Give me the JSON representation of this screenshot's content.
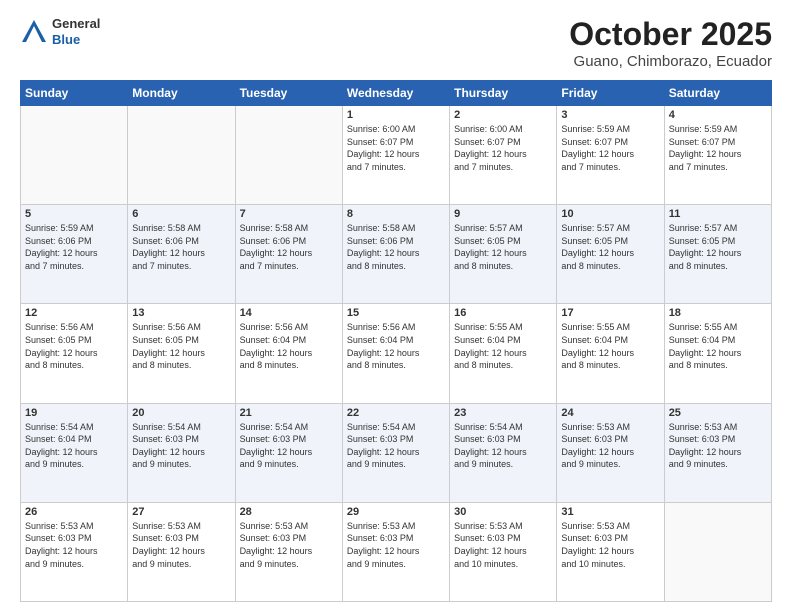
{
  "header": {
    "logo": {
      "general": "General",
      "blue": "Blue"
    },
    "title": "October 2025",
    "subtitle": "Guano, Chimborazo, Ecuador"
  },
  "weekdays": [
    "Sunday",
    "Monday",
    "Tuesday",
    "Wednesday",
    "Thursday",
    "Friday",
    "Saturday"
  ],
  "weeks": [
    [
      {
        "day": "",
        "info": ""
      },
      {
        "day": "",
        "info": ""
      },
      {
        "day": "",
        "info": ""
      },
      {
        "day": "1",
        "info": "Sunrise: 6:00 AM\nSunset: 6:07 PM\nDaylight: 12 hours\nand 7 minutes."
      },
      {
        "day": "2",
        "info": "Sunrise: 6:00 AM\nSunset: 6:07 PM\nDaylight: 12 hours\nand 7 minutes."
      },
      {
        "day": "3",
        "info": "Sunrise: 5:59 AM\nSunset: 6:07 PM\nDaylight: 12 hours\nand 7 minutes."
      },
      {
        "day": "4",
        "info": "Sunrise: 5:59 AM\nSunset: 6:07 PM\nDaylight: 12 hours\nand 7 minutes."
      }
    ],
    [
      {
        "day": "5",
        "info": "Sunrise: 5:59 AM\nSunset: 6:06 PM\nDaylight: 12 hours\nand 7 minutes."
      },
      {
        "day": "6",
        "info": "Sunrise: 5:58 AM\nSunset: 6:06 PM\nDaylight: 12 hours\nand 7 minutes."
      },
      {
        "day": "7",
        "info": "Sunrise: 5:58 AM\nSunset: 6:06 PM\nDaylight: 12 hours\nand 7 minutes."
      },
      {
        "day": "8",
        "info": "Sunrise: 5:58 AM\nSunset: 6:06 PM\nDaylight: 12 hours\nand 8 minutes."
      },
      {
        "day": "9",
        "info": "Sunrise: 5:57 AM\nSunset: 6:05 PM\nDaylight: 12 hours\nand 8 minutes."
      },
      {
        "day": "10",
        "info": "Sunrise: 5:57 AM\nSunset: 6:05 PM\nDaylight: 12 hours\nand 8 minutes."
      },
      {
        "day": "11",
        "info": "Sunrise: 5:57 AM\nSunset: 6:05 PM\nDaylight: 12 hours\nand 8 minutes."
      }
    ],
    [
      {
        "day": "12",
        "info": "Sunrise: 5:56 AM\nSunset: 6:05 PM\nDaylight: 12 hours\nand 8 minutes."
      },
      {
        "day": "13",
        "info": "Sunrise: 5:56 AM\nSunset: 6:05 PM\nDaylight: 12 hours\nand 8 minutes."
      },
      {
        "day": "14",
        "info": "Sunrise: 5:56 AM\nSunset: 6:04 PM\nDaylight: 12 hours\nand 8 minutes."
      },
      {
        "day": "15",
        "info": "Sunrise: 5:56 AM\nSunset: 6:04 PM\nDaylight: 12 hours\nand 8 minutes."
      },
      {
        "day": "16",
        "info": "Sunrise: 5:55 AM\nSunset: 6:04 PM\nDaylight: 12 hours\nand 8 minutes."
      },
      {
        "day": "17",
        "info": "Sunrise: 5:55 AM\nSunset: 6:04 PM\nDaylight: 12 hours\nand 8 minutes."
      },
      {
        "day": "18",
        "info": "Sunrise: 5:55 AM\nSunset: 6:04 PM\nDaylight: 12 hours\nand 8 minutes."
      }
    ],
    [
      {
        "day": "19",
        "info": "Sunrise: 5:54 AM\nSunset: 6:04 PM\nDaylight: 12 hours\nand 9 minutes."
      },
      {
        "day": "20",
        "info": "Sunrise: 5:54 AM\nSunset: 6:03 PM\nDaylight: 12 hours\nand 9 minutes."
      },
      {
        "day": "21",
        "info": "Sunrise: 5:54 AM\nSunset: 6:03 PM\nDaylight: 12 hours\nand 9 minutes."
      },
      {
        "day": "22",
        "info": "Sunrise: 5:54 AM\nSunset: 6:03 PM\nDaylight: 12 hours\nand 9 minutes."
      },
      {
        "day": "23",
        "info": "Sunrise: 5:54 AM\nSunset: 6:03 PM\nDaylight: 12 hours\nand 9 minutes."
      },
      {
        "day": "24",
        "info": "Sunrise: 5:53 AM\nSunset: 6:03 PM\nDaylight: 12 hours\nand 9 minutes."
      },
      {
        "day": "25",
        "info": "Sunrise: 5:53 AM\nSunset: 6:03 PM\nDaylight: 12 hours\nand 9 minutes."
      }
    ],
    [
      {
        "day": "26",
        "info": "Sunrise: 5:53 AM\nSunset: 6:03 PM\nDaylight: 12 hours\nand 9 minutes."
      },
      {
        "day": "27",
        "info": "Sunrise: 5:53 AM\nSunset: 6:03 PM\nDaylight: 12 hours\nand 9 minutes."
      },
      {
        "day": "28",
        "info": "Sunrise: 5:53 AM\nSunset: 6:03 PM\nDaylight: 12 hours\nand 9 minutes."
      },
      {
        "day": "29",
        "info": "Sunrise: 5:53 AM\nSunset: 6:03 PM\nDaylight: 12 hours\nand 9 minutes."
      },
      {
        "day": "30",
        "info": "Sunrise: 5:53 AM\nSunset: 6:03 PM\nDaylight: 12 hours\nand 10 minutes."
      },
      {
        "day": "31",
        "info": "Sunrise: 5:53 AM\nSunset: 6:03 PM\nDaylight: 12 hours\nand 10 minutes."
      },
      {
        "day": "",
        "info": ""
      }
    ]
  ]
}
